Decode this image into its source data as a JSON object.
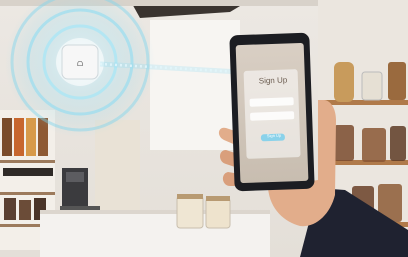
{
  "scene": {
    "description_tag": "wifi-access-point-and-phone-signup",
    "colors": {
      "wall": "#f1eeea",
      "ceiling_band": "#2a2623",
      "counter": "#f4f2ef",
      "shelf_wood": "#b07a4a",
      "wifi_glow": "#7fd4ee",
      "phone_body": "#1c1d22",
      "hand": "#e2ad8b",
      "sleeve": "#1f2230"
    }
  },
  "phone": {
    "signup_title": "Sign Up",
    "submit_label": "Sign Up"
  }
}
